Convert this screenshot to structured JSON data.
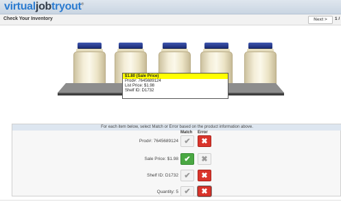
{
  "header": {
    "logo_part1": "virtual",
    "logo_part2": "job",
    "logo_part3": "tryout",
    "logo_mark": "®"
  },
  "titlebar": {
    "title": "Check Your Inventory",
    "next_label": "Next >",
    "page_indicator": "1 /"
  },
  "price_tag": {
    "sale_line": "$1.80 (Sale Price)",
    "prod": "Prod#: 7645689124",
    "list_price": "List Price: $1.98",
    "shelf_id": "Shelf ID: D1732"
  },
  "panel": {
    "instruction": "For each item below, select Match or Error based on the product information above.",
    "match_header": "Match",
    "error_header": "Error",
    "rows": [
      {
        "label": "Prod#: 7645689124",
        "match_selected": false,
        "error_selected": true
      },
      {
        "label": "Sale Price: $1.98",
        "match_selected": true,
        "error_selected": false
      },
      {
        "label": "Shelf ID: D1732",
        "match_selected": false,
        "error_selected": true
      },
      {
        "label": "Quantity: 5",
        "match_selected": false,
        "error_selected": true
      }
    ]
  },
  "icons": {
    "match": "check-icon",
    "error": "x-icon"
  },
  "colors": {
    "match_on": "#4aa843",
    "error_on": "#d9342b",
    "sale_highlight": "#ffff00",
    "lid": "#2a3f94"
  }
}
